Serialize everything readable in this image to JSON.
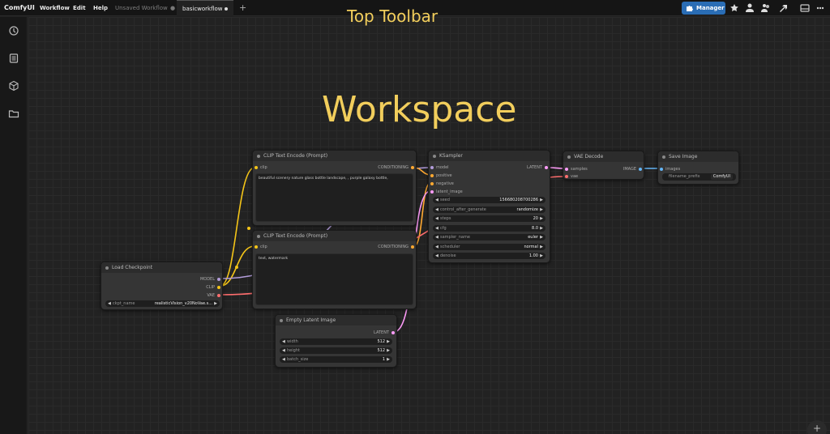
{
  "topbar": {
    "brand": "ComfyUI",
    "menu": [
      "Workflow",
      "Edit",
      "Help"
    ],
    "tabs": [
      {
        "label": "Unsaved Workflow"
      },
      {
        "label": "basicworkflow"
      }
    ],
    "manager_label": "Manager"
  },
  "labels": {
    "toolbar": "Top Toolbar",
    "workspace": "Workspace"
  },
  "nodes": {
    "clip_pos": {
      "title": "CLIP Text Encode (Prompt)",
      "input": "clip",
      "output": "CONDITIONING",
      "text": "beautiful scenery nature glass bottle landscape, , purple galaxy bottle,"
    },
    "clip_neg": {
      "title": "CLIP Text Encode (Prompt)",
      "input": "clip",
      "output": "CONDITIONING",
      "text": "text, watermark"
    },
    "checkpoint": {
      "title": "Load Checkpoint",
      "outputs": [
        "MODEL",
        "CLIP",
        "VAE"
      ],
      "widget_name": "ckpt_name",
      "widget_value": "realisticVision_v20NoVae.s..."
    },
    "ksampler": {
      "title": "KSampler",
      "inputs": [
        "model",
        "positive",
        "negative",
        "latent_image"
      ],
      "output": "LATENT",
      "widgets": [
        {
          "name": "seed",
          "value": "156680208700286"
        },
        {
          "name": "control_after_generate",
          "value": "randomize"
        },
        {
          "name": "steps",
          "value": "20"
        },
        {
          "name": "cfg",
          "value": "8.0"
        },
        {
          "name": "sampler_name",
          "value": "euler"
        },
        {
          "name": "scheduler",
          "value": "normal"
        },
        {
          "name": "denoise",
          "value": "1.00"
        }
      ]
    },
    "vae_decode": {
      "title": "VAE Decode",
      "inputs": [
        "samples",
        "vae"
      ],
      "output": "IMAGE"
    },
    "save_image": {
      "title": "Save Image",
      "input": "images",
      "widget_name": "filename_prefix",
      "widget_value": "ComfyUI"
    },
    "latent": {
      "title": "Empty Latent Image",
      "output": "LATENT",
      "widgets": [
        {
          "name": "width",
          "value": "512"
        },
        {
          "name": "height",
          "value": "512"
        },
        {
          "name": "batch_size",
          "value": "1"
        }
      ]
    }
  },
  "colors": {
    "clip": "#f5c518",
    "conditioning": "#ffa931",
    "model": "#b39ddb",
    "vae": "#ff6e6e",
    "latent": "#ff9cf9",
    "image": "#64b5f6",
    "accent": "#2a6db5"
  },
  "icons": {
    "sidebar": [
      "history-icon",
      "queue-icon",
      "node-library-icon",
      "workflows-icon"
    ],
    "toolbar": [
      "puzzle-icon",
      "star-icon",
      "user-icon",
      "group-icon",
      "share-icon",
      "panel-icon",
      "more-icon"
    ]
  }
}
